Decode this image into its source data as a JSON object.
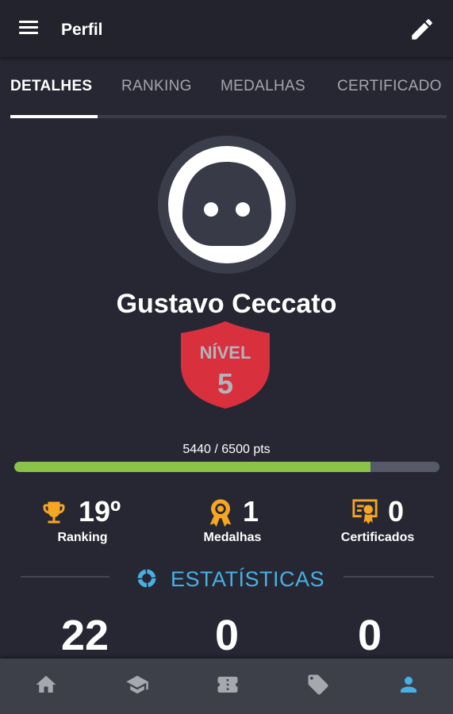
{
  "appbar": {
    "title": "Perfil",
    "menu_icon": "menu-icon",
    "edit_icon": "pencil-icon"
  },
  "tabs": [
    {
      "label": "DETALHES",
      "active": true
    },
    {
      "label": "RANKING",
      "active": false
    },
    {
      "label": "MEDALHAS",
      "active": false
    },
    {
      "label": "CERTIFICADO",
      "active": false
    }
  ],
  "profile": {
    "name": "Gustavo Ceccato",
    "level_label": "NÍVEL",
    "level_value": "5",
    "points_text": "5440 / 6500 pts",
    "progress_fraction": 0.837
  },
  "stats": [
    {
      "icon": "trophy-icon",
      "value": "19º",
      "label": "Ranking"
    },
    {
      "icon": "medal-icon",
      "value": "1",
      "label": "Medalhas"
    },
    {
      "icon": "certificate-icon",
      "value": "0",
      "label": "Certificados"
    }
  ],
  "statistics": {
    "title": "ESTATÍSTICAS",
    "icon": "donut-chart-icon",
    "values": [
      "22",
      "0",
      "0"
    ]
  },
  "bottom_nav": [
    {
      "icon": "home-icon",
      "active": false
    },
    {
      "icon": "graduation-cap-icon",
      "active": false
    },
    {
      "icon": "ticket-icon",
      "active": false
    },
    {
      "icon": "tag-icon",
      "active": false
    },
    {
      "icon": "person-icon",
      "active": true
    }
  ],
  "colors": {
    "background": "#262733",
    "accent": "#48b0e3",
    "level_badge": "#d9303e",
    "progress": "#8bc34a",
    "stat_icons": "#f5a623"
  }
}
